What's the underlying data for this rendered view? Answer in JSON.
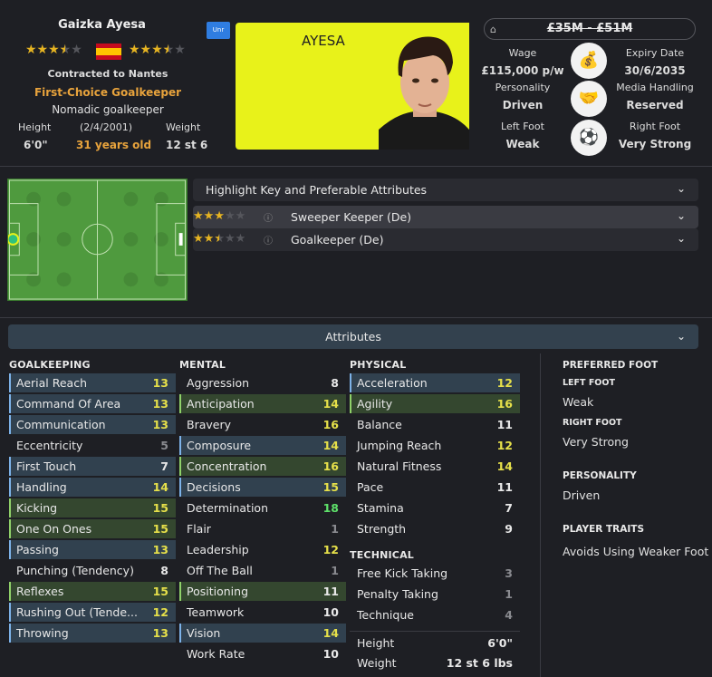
{
  "player": {
    "name": "Gaizka Ayesa",
    "contract": "Contracted to Nantes",
    "role": "First-Choice Goalkeeper",
    "description": "Nomadic goalkeeper",
    "height_label": "Height",
    "height": "6'0\"",
    "dob": "(2/4/2001)",
    "age": "31 years old",
    "weight_label": "Weight",
    "weight": "12 st 6",
    "current_ability_stars": 3.5,
    "potential_ability_stars": 3.5,
    "nationality_flag": "spain-flag",
    "badge": "Unr"
  },
  "kit": {
    "name": "AYESA",
    "color": "#e8f21a"
  },
  "value": {
    "range": "£35M - £51M"
  },
  "contract_info": {
    "wage_label": "Wage",
    "wage": "£115,000 p/w",
    "expiry_label": "Expiry Date",
    "expiry": "30/6/2035",
    "personality_label": "Personality",
    "personality": "Driven",
    "media_label": "Media Handling",
    "media": "Reserved",
    "left_foot_label": "Left Foot",
    "left_foot": "Weak",
    "right_foot_label": "Right Foot",
    "right_foot": "Very Strong"
  },
  "roles": {
    "highlight_label": "Highlight Key and Preferable Attributes",
    "items": [
      {
        "stars": 3,
        "label": "Sweeper Keeper (De)"
      },
      {
        "stars": 2.5,
        "label": "Goalkeeper (De)"
      }
    ]
  },
  "attributes_label": "Attributes",
  "goalkeeping": {
    "title": "GOALKEEPING",
    "rows": [
      {
        "name": "Aerial Reach",
        "value": "13"
      },
      {
        "name": "Command Of Area",
        "value": "13"
      },
      {
        "name": "Communication",
        "value": "13"
      },
      {
        "name": "Eccentricity",
        "value": "5"
      },
      {
        "name": "First Touch",
        "value": "7"
      },
      {
        "name": "Handling",
        "value": "14"
      },
      {
        "name": "Kicking",
        "value": "15"
      },
      {
        "name": "One On Ones",
        "value": "15"
      },
      {
        "name": "Passing",
        "value": "13"
      },
      {
        "name": "Punching (Tendency)",
        "value": "8"
      },
      {
        "name": "Reflexes",
        "value": "15"
      },
      {
        "name": "Rushing Out (Tende...",
        "value": "12"
      },
      {
        "name": "Throwing",
        "value": "13"
      }
    ]
  },
  "mental": {
    "title": "MENTAL",
    "rows": [
      {
        "name": "Aggression",
        "value": "8"
      },
      {
        "name": "Anticipation",
        "value": "14"
      },
      {
        "name": "Bravery",
        "value": "16"
      },
      {
        "name": "Composure",
        "value": "14"
      },
      {
        "name": "Concentration",
        "value": "16"
      },
      {
        "name": "Decisions",
        "value": "15"
      },
      {
        "name": "Determination",
        "value": "18"
      },
      {
        "name": "Flair",
        "value": "1"
      },
      {
        "name": "Leadership",
        "value": "12"
      },
      {
        "name": "Off The Ball",
        "value": "1"
      },
      {
        "name": "Positioning",
        "value": "11"
      },
      {
        "name": "Teamwork",
        "value": "10"
      },
      {
        "name": "Vision",
        "value": "14"
      },
      {
        "name": "Work Rate",
        "value": "10"
      }
    ]
  },
  "physical": {
    "title": "PHYSICAL",
    "rows": [
      {
        "name": "Acceleration",
        "value": "12"
      },
      {
        "name": "Agility",
        "value": "16"
      },
      {
        "name": "Balance",
        "value": "11"
      },
      {
        "name": "Jumping Reach",
        "value": "12"
      },
      {
        "name": "Natural Fitness",
        "value": "14"
      },
      {
        "name": "Pace",
        "value": "11"
      },
      {
        "name": "Stamina",
        "value": "7"
      },
      {
        "name": "Strength",
        "value": "9"
      }
    ]
  },
  "technical": {
    "title": "TECHNICAL",
    "rows": [
      {
        "name": "Free Kick Taking",
        "value": "3"
      },
      {
        "name": "Penalty Taking",
        "value": "1"
      },
      {
        "name": "Technique",
        "value": "4"
      }
    ]
  },
  "body": {
    "height_label": "Height",
    "height": "6'0\"",
    "weight_label": "Weight",
    "weight": "12 st 6 lbs"
  },
  "side": {
    "preferred_foot_title": "PREFERRED FOOT",
    "left_foot_title": "LEFT FOOT",
    "left_foot": "Weak",
    "right_foot_title": "RIGHT FOOT",
    "right_foot": "Very Strong",
    "personality_title": "PERSONALITY",
    "personality": "Driven",
    "traits_title": "PLAYER TRAITS",
    "trait": "Avoids Using Weaker Foot"
  }
}
